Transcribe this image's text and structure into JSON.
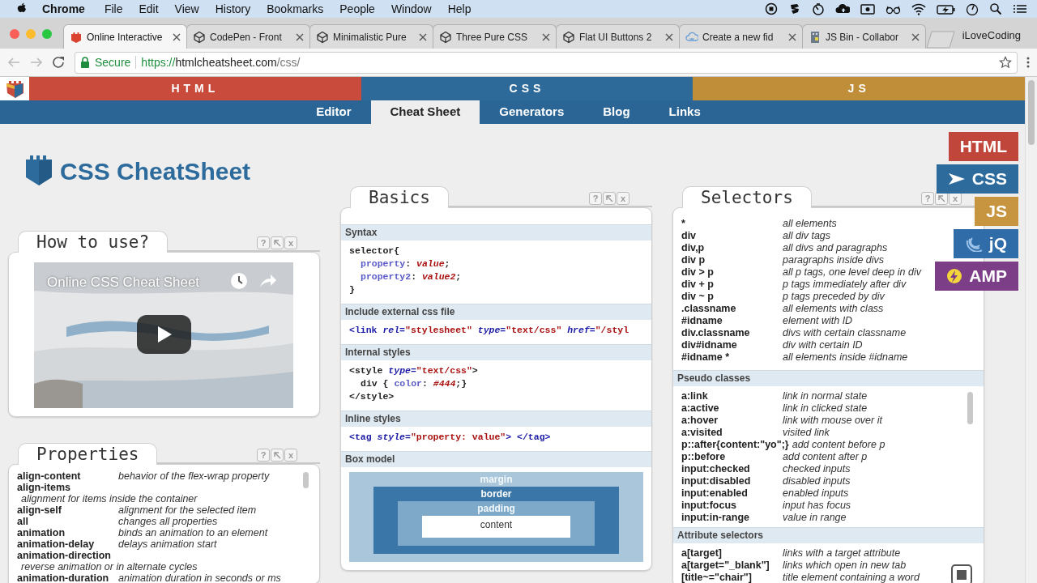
{
  "menubar": {
    "app": "Chrome",
    "items": [
      "File",
      "Edit",
      "View",
      "History",
      "Bookmarks",
      "People",
      "Window",
      "Help"
    ]
  },
  "browser": {
    "tabs": [
      {
        "title": "Online Interactive",
        "selected": true
      },
      {
        "title": "CodePen - Front",
        "selected": false
      },
      {
        "title": "Minimalistic Pure",
        "selected": false
      },
      {
        "title": "Three Pure CSS",
        "selected": false
      },
      {
        "title": "Flat UI Buttons 2",
        "selected": false
      },
      {
        "title": "Create a new fid",
        "selected": false
      },
      {
        "title": "JS Bin - Collabor",
        "selected": false
      }
    ],
    "profile": "iLoveCoding",
    "secure_label": "Secure",
    "url": {
      "scheme": "https://",
      "host": "htmlcheatsheet.com",
      "path": "/css/"
    }
  },
  "site": {
    "sections": [
      {
        "label": "HTML",
        "color": "#c84b3c"
      },
      {
        "label": "CSS",
        "color": "#2d6a9a"
      },
      {
        "label": "JS",
        "color": "#c08e38"
      }
    ],
    "nav": [
      {
        "label": "Editor",
        "selected": false
      },
      {
        "label": "Cheat Sheet",
        "selected": true
      },
      {
        "label": "Generators",
        "selected": false
      },
      {
        "label": "Blog",
        "selected": false
      },
      {
        "label": "Links",
        "selected": false
      }
    ],
    "logo_title": "CSS CheatSheet",
    "side_buttons": [
      {
        "label": "HTML",
        "color": "#c0463b"
      },
      {
        "label": "CSS",
        "color": "#2d6b9c"
      },
      {
        "label": "JS",
        "color": "#c79440"
      },
      {
        "label": "jQ",
        "color": "#2f6ca8"
      },
      {
        "label": "AMP",
        "color": "#7c3f87"
      }
    ]
  },
  "how_to_use": {
    "title": "How to use?",
    "help": "?",
    "close": "x",
    "video": {
      "title": "Online CSS Cheat Sheet"
    }
  },
  "properties": {
    "title": "Properties",
    "help": "?",
    "close": "x",
    "rows": [
      {
        "name": "align-content",
        "description": "behavior of the flex-wrap property",
        "wrapped": false
      },
      {
        "name": "align-items",
        "description": "alignment for items inside the container",
        "wrapped": true
      },
      {
        "name": "align-self",
        "description": "alignment for the selected item",
        "wrapped": false
      },
      {
        "name": "all",
        "description": "changes all properties",
        "wrapped": false
      },
      {
        "name": "animation",
        "description": "binds an animation to an element",
        "wrapped": false
      },
      {
        "name": "animation-delay",
        "description": "delays animation start",
        "wrapped": false
      },
      {
        "name": "animation-direction",
        "description": "reverse animation or in alternate cycles",
        "wrapped": true
      },
      {
        "name": "animation-duration",
        "description": "animation duration in seconds or ms",
        "wrapped": false
      }
    ]
  },
  "basics": {
    "title": "Basics",
    "help": "?",
    "close": "x",
    "sections": [
      {
        "heading": "Syntax",
        "kind": "code",
        "lines": [
          {
            "indented": false,
            "tokens": [
              {
                "kind": "plain",
                "text": "selector{"
              }
            ]
          },
          {
            "indented": true,
            "tokens": [
              {
                "kind": "prop",
                "text": "property"
              },
              {
                "kind": "plain",
                "text": ": "
              },
              {
                "kind": "value",
                "text": "value"
              },
              {
                "kind": "plain",
                "text": ";"
              }
            ]
          },
          {
            "indented": true,
            "tokens": [
              {
                "kind": "prop",
                "text": "property2"
              },
              {
                "kind": "plain",
                "text": ": "
              },
              {
                "kind": "value",
                "text": "value2"
              },
              {
                "kind": "plain",
                "text": ";"
              }
            ]
          },
          {
            "indented": false,
            "tokens": [
              {
                "kind": "plain",
                "text": "}"
              }
            ]
          }
        ]
      },
      {
        "heading": "Include external css file",
        "kind": "code",
        "lines": [
          {
            "indented": false,
            "tokens": [
              {
                "kind": "tag",
                "text": "<link"
              },
              {
                "kind": "attr",
                "text": " rel="
              },
              {
                "kind": "string",
                "text": "\"stylesheet\""
              },
              {
                "kind": "attr",
                "text": " type="
              },
              {
                "kind": "string",
                "text": "\"text/css\""
              },
              {
                "kind": "attr",
                "text": " href="
              },
              {
                "kind": "string",
                "text": "\"/styl"
              }
            ]
          }
        ]
      },
      {
        "heading": "Internal styles",
        "kind": "code",
        "lines": [
          {
            "indented": false,
            "tokens": [
              {
                "kind": "plain",
                "text": "<style"
              },
              {
                "kind": "attr",
                "text": " type="
              },
              {
                "kind": "string",
                "text": "\"text/css\""
              },
              {
                "kind": "plain",
                "text": ">"
              }
            ]
          },
          {
            "indented": true,
            "tokens": [
              {
                "kind": "plain",
                "text": "div { "
              },
              {
                "kind": "prop",
                "text": "color"
              },
              {
                "kind": "plain",
                "text": ": "
              },
              {
                "kind": "value",
                "text": "#444"
              },
              {
                "kind": "plain",
                "text": ";}"
              }
            ]
          },
          {
            "indented": false,
            "tokens": [
              {
                "kind": "plain",
                "text": "</style>"
              }
            ]
          }
        ]
      },
      {
        "heading": "Inline styles",
        "kind": "code",
        "lines": [
          {
            "indented": false,
            "tokens": [
              {
                "kind": "tag",
                "text": "<tag"
              },
              {
                "kind": "attr",
                "text": " style="
              },
              {
                "kind": "string",
                "text": "\"property: value\""
              },
              {
                "kind": "tag",
                "text": "> </tag>"
              }
            ]
          }
        ]
      },
      {
        "heading": "Box model",
        "kind": "box_model",
        "layers": [
          "margin",
          "border",
          "padding",
          "content"
        ]
      }
    ]
  },
  "selectors": {
    "title": "Selectors",
    "help": "?",
    "close": "x",
    "rows": [
      {
        "name": "*",
        "description": "all elements"
      },
      {
        "name": "div",
        "description": "all div tags"
      },
      {
        "name": "div,p",
        "description": "all divs and paragraphs"
      },
      {
        "name": "div p",
        "description": "paragraphs inside divs"
      },
      {
        "name": "div > p",
        "description": "all p tags, one level deep in div"
      },
      {
        "name": "div + p",
        "description": "p tags immediately after div"
      },
      {
        "name": "div ~ p",
        "description": "p tags preceded by div"
      },
      {
        "name": ".classname",
        "description": "all elements with class"
      },
      {
        "name": "#idname",
        "description": "element with ID"
      },
      {
        "name": "div.classname",
        "description": "divs with certain classname"
      },
      {
        "name": "div#idname",
        "description": "div with certain ID"
      },
      {
        "name": "#idname *",
        "description": "all elements inside #idname"
      }
    ],
    "groups": [
      {
        "heading": "Pseudo classes",
        "scrollable": true,
        "rows": [
          {
            "name": "a:link",
            "description": "link in normal state"
          },
          {
            "name": "a:active",
            "description": "link in clicked state"
          },
          {
            "name": "a:hover",
            "description": "link with mouse over it"
          },
          {
            "name": "a:visited",
            "description": "visited link"
          },
          {
            "name": "p::after{content:\"yo\";}",
            "description": "add content before p"
          },
          {
            "name": "p::before",
            "description": "add content after p"
          },
          {
            "name": "input:checked",
            "description": "checked inputs"
          },
          {
            "name": "input:disabled",
            "description": "disabled inputs"
          },
          {
            "name": "input:enabled",
            "description": "enabled inputs"
          },
          {
            "name": "input:focus",
            "description": "input has focus"
          },
          {
            "name": "input:in-range",
            "description": "value in range"
          }
        ]
      },
      {
        "heading": "Attribute selectors",
        "scrollable": false,
        "rows": [
          {
            "name": "a[target]",
            "description": "links with a target attribute"
          },
          {
            "name": "a[target=\"_blank\"]",
            "description": "links which open in new tab"
          },
          {
            "name": "[title~=\"chair\"]",
            "description": "title element containing a word"
          }
        ]
      }
    ]
  }
}
